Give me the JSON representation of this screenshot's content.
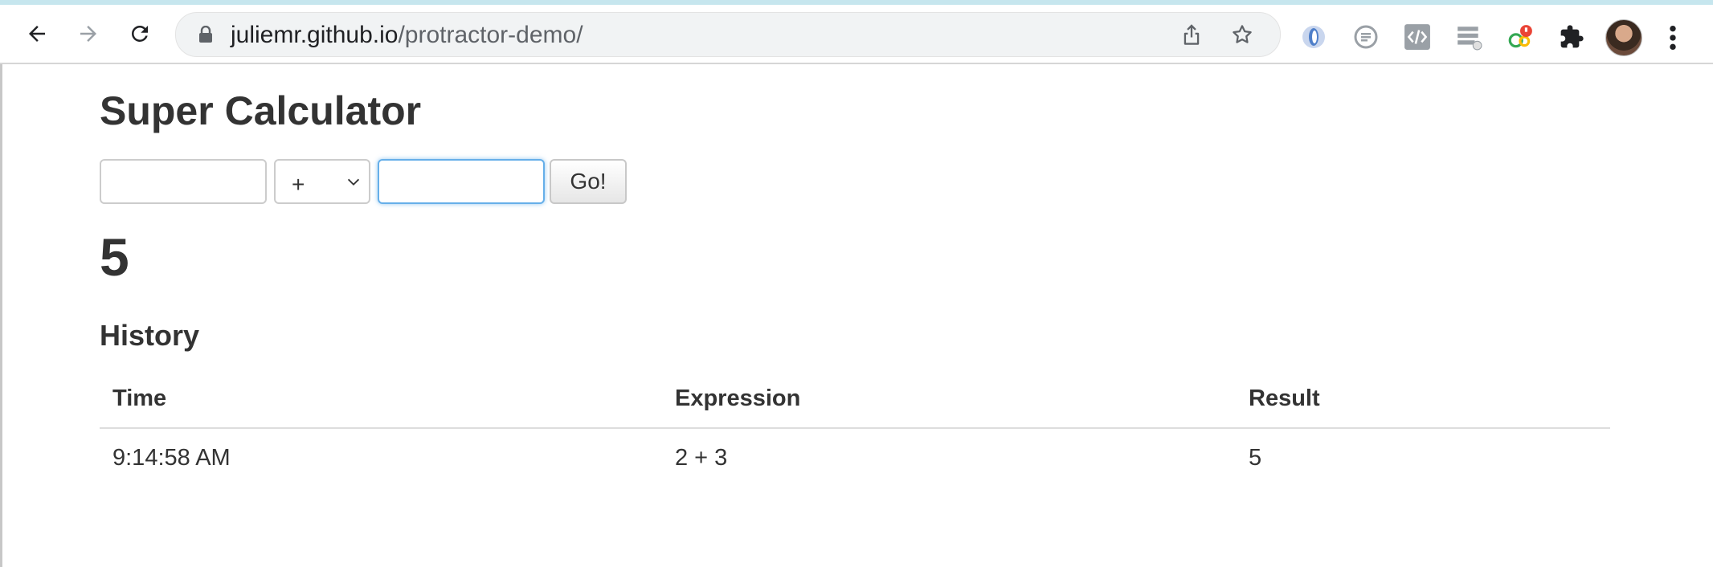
{
  "browser": {
    "url_host": "juliemr.github.io",
    "url_path": "/protractor-demo/",
    "back_icon": "back-arrow-icon",
    "forward_icon": "forward-arrow-icon",
    "reload_icon": "reload-icon",
    "extensions": [
      "extension-blue-icon",
      "extension-reader-icon",
      "extension-code-icon",
      "extension-layers-icon",
      "extension-google-icon",
      "puzzle-icon"
    ]
  },
  "app": {
    "title": "Super Calculator"
  },
  "calculator": {
    "first_value": "",
    "operator": "+",
    "second_value": "",
    "go_label": "Go!",
    "result": "5"
  },
  "history": {
    "heading": "History",
    "columns": [
      "Time",
      "Expression",
      "Result"
    ],
    "rows": [
      {
        "time": "9:14:58 AM",
        "expression": "2 + 3",
        "result": "5"
      }
    ]
  }
}
